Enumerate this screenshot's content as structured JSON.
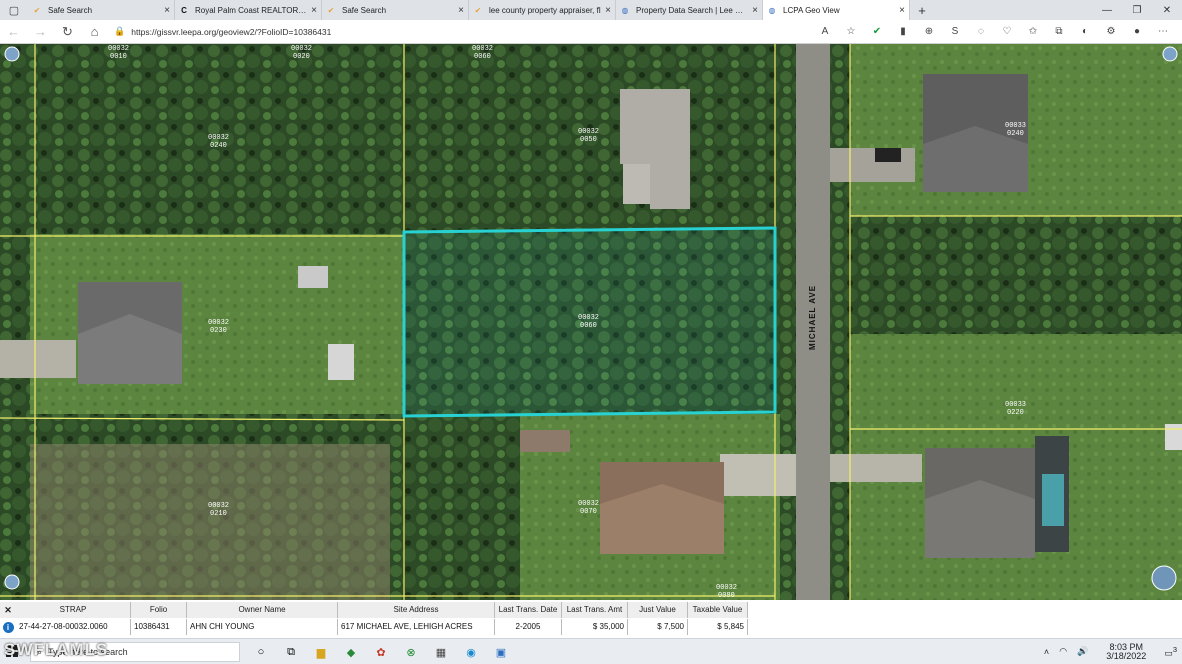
{
  "tabs": [
    {
      "title": "Safe Search",
      "icon": "shield-check-icon",
      "color": "#e8a33b"
    },
    {
      "title": "Royal Palm Coast REALTOR® Asso",
      "icon": "c-logo-icon",
      "color": "#111111"
    },
    {
      "title": "Safe Search",
      "icon": "shield-check-icon",
      "color": "#e8a33b"
    },
    {
      "title": "lee county property appraiser, fl",
      "icon": "shield-check-icon",
      "color": "#e8a33b"
    },
    {
      "title": "Property Data Search | Lee Count",
      "icon": "globe-icon",
      "color": "#3a70c2"
    },
    {
      "title": "LCPA Geo View",
      "icon": "globe-icon",
      "color": "#3a70c2"
    }
  ],
  "address": {
    "url": "https://gissvr.leepa.org/geoview2/?FolioID=10386431"
  },
  "map": {
    "street_name": "MICHAEL AVE",
    "highlight_color": "#28d2d2",
    "parcel_line_color": "#f2ee6a",
    "parcel_labels": [
      {
        "id": "l1",
        "line1": "00032",
        "line2": "0010"
      },
      {
        "id": "l2",
        "line1": "00032",
        "line2": "0020"
      },
      {
        "id": "l3",
        "line1": "00032",
        "line2": "0060"
      },
      {
        "id": "l4",
        "line1": "00032",
        "line2": "0240"
      },
      {
        "id": "l5",
        "line1": "00032",
        "line2": "0050"
      },
      {
        "id": "l6",
        "line1": "00033",
        "line2": "0240"
      },
      {
        "id": "l7",
        "line1": "00032",
        "line2": "0230"
      },
      {
        "id": "l8",
        "line1": "00032",
        "line2": "0060"
      },
      {
        "id": "l9",
        "line1": "00033",
        "line2": "0220"
      },
      {
        "id": "l10",
        "line1": "00032",
        "line2": "0070"
      },
      {
        "id": "l11",
        "line1": "00032",
        "line2": "0210"
      },
      {
        "id": "l12",
        "line1": "00032",
        "line2": "0080"
      }
    ]
  },
  "grid": {
    "headers": [
      "STRAP",
      "Folio",
      "Owner Name",
      "Site Address",
      "Last Trans. Date",
      "Last Trans. Amt",
      "Just Value",
      "Taxable Value"
    ],
    "row": [
      "27-44-27-08-00032.0060",
      "10386431",
      "AHN CHI YOUNG",
      "617 MICHAEL AVE, LEHIGH ACRES",
      "2-2005",
      "$ 35,000",
      "$ 7,500",
      "$ 5,845"
    ]
  },
  "taskbar": {
    "search_placeholder": "Type here to search",
    "time": "8:03 PM",
    "date": "3/18/2022",
    "notification_count": "3"
  },
  "watermark": "SWFLAMLS"
}
